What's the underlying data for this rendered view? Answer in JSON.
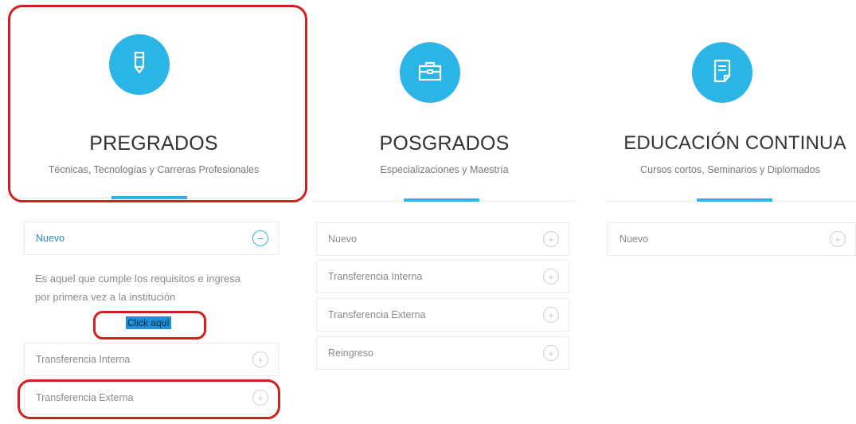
{
  "columns": [
    {
      "icon": "pencil-icon",
      "title": "PREGRADOS",
      "subtitle": "Técnicas, Tecnologías y Carreras Profesionales",
      "items": [
        {
          "label": "Nuevo"
        },
        {
          "label": "Transferencia Interna"
        },
        {
          "label": "Transferencia Externa"
        }
      ],
      "expanded": {
        "description_line1": "Es aquel que cumple los requisitos e ingresa",
        "description_line2": "por primera vez a la institución",
        "link": "Click aquí"
      }
    },
    {
      "icon": "briefcase-icon",
      "title": "POSGRADOS",
      "subtitle": "Especializaciones y Maestría",
      "items": [
        {
          "label": "Nuevo"
        },
        {
          "label": "Transferencia Interna"
        },
        {
          "label": "Transferencia Externa"
        },
        {
          "label": "Reingreso"
        }
      ]
    },
    {
      "icon": "document-icon",
      "title": "EDUCACIÓN CONTINUA",
      "subtitle": "Cursos cortos, Seminarios y Diplomados",
      "items": [
        {
          "label": "Nuevo"
        }
      ]
    }
  ],
  "colors": {
    "accent": "#2bb5e6",
    "annotation": "#d41f1f"
  }
}
